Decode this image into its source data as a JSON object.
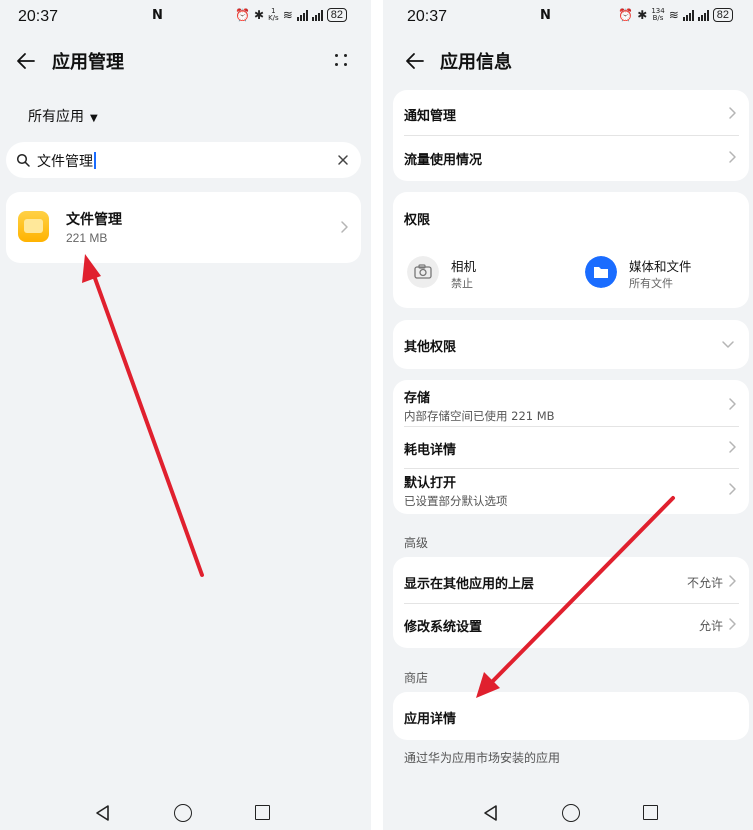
{
  "left": {
    "status": {
      "time": "20:37",
      "nfc": "N",
      "speed": "1\nK/s",
      "battery": "82"
    },
    "title": "应用管理",
    "filter": {
      "label": "所有应用",
      "caret": "▼"
    },
    "search": {
      "value": "文件管理"
    },
    "app": {
      "name": "文件管理",
      "size": "221 MB"
    }
  },
  "right": {
    "status": {
      "time": "20:37",
      "nfc": "N",
      "speed": "134\nB/s",
      "battery": "82"
    },
    "title": "应用信息",
    "rows": {
      "notifications": "通知管理",
      "data_usage": "流量使用情况",
      "permissions_title": "权限",
      "camera": {
        "name": "相机",
        "status": "禁止"
      },
      "media": {
        "name": "媒体和文件",
        "status": "所有文件"
      },
      "other_permissions": "其他权限",
      "storage": {
        "label": "存储",
        "sub": "内部存储空间已使用 221 MB"
      },
      "power": "耗电详情",
      "default_open": {
        "label": "默认打开",
        "sub": "已设置部分默认选项"
      }
    },
    "advanced": {
      "label": "高级",
      "overlay": {
        "label": "显示在其他应用的上层",
        "value": "不允许"
      },
      "modify_settings": {
        "label": "修改系统设置",
        "value": "允许"
      }
    },
    "store": {
      "label": "商店",
      "app_details": "应用详情",
      "note": "通过华为应用市场安装的应用"
    }
  },
  "colors": {
    "accent": "#1a6cff",
    "annotation_arrow": "#e0202e",
    "app_icon": "#ffc21a",
    "background": "#f1f3f5"
  },
  "icons": [
    "back-arrow-icon",
    "more-icon",
    "search-icon",
    "clear-icon",
    "chevron-right-icon",
    "chevron-down-icon",
    "camera-icon",
    "folder-icon",
    "nav-back-icon",
    "nav-home-icon",
    "nav-recent-icon"
  ]
}
